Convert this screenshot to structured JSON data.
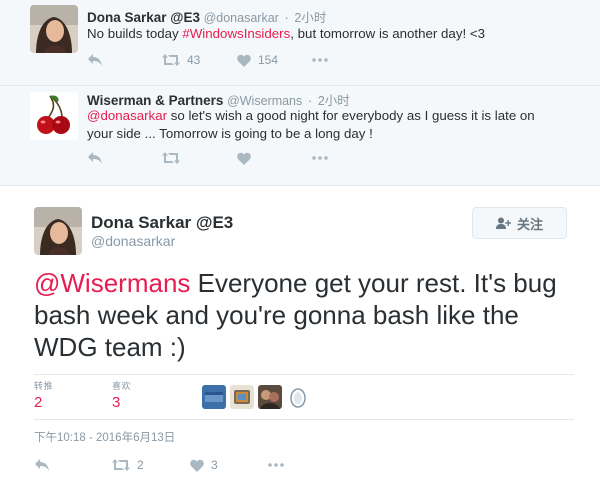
{
  "tweets": [
    {
      "name": "Dona Sarkar @E3",
      "handle": "@donasarkar",
      "time": "2小时",
      "text_before": "No builds today ",
      "hashtag": "#WindowsInsiders",
      "text_after": ", but tomorrow is another day! <3",
      "retweets": "43",
      "likes": "154"
    },
    {
      "name": "Wiserman & Partners",
      "handle": "@Wisermans",
      "time": "2小时",
      "mention": "@donasarkar",
      "text_after": " so let's wish a good night for everybody as I guess it is late on your side ... Tomorrow is going to be a long day !"
    }
  ],
  "main": {
    "name": "Dona Sarkar @E3",
    "handle": "@donasarkar",
    "follow_label": "关注",
    "mention": "@Wisermans",
    "text": " Everyone get your rest. It's bug bash week and you're gonna bash like the WDG team :)",
    "retweet_label": "转推",
    "retweet_count": "2",
    "like_label": "喜欢",
    "like_count": "3",
    "timestamp": "下午10:18 - 2016年6月13日",
    "action_retweets": "2",
    "action_likes": "3"
  },
  "colors": {
    "accent": "#e81c4f",
    "muted": "#8899a6",
    "icon": "#aab8c2"
  },
  "icons": [
    "reply-icon",
    "retweet-icon",
    "like-icon",
    "more-icon",
    "follow-user-icon"
  ]
}
